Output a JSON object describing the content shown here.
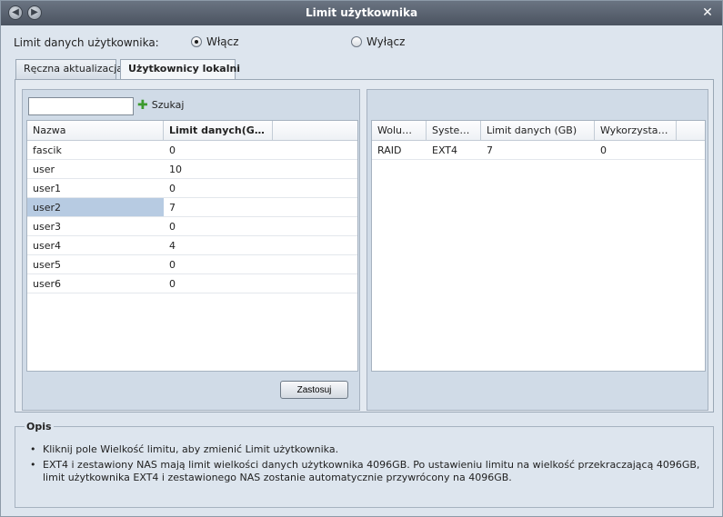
{
  "window": {
    "title": "Limit użytkownika"
  },
  "limit": {
    "label": "Limit danych użytkownika:",
    "on": "Włącz",
    "off": "Wyłącz",
    "selected": "on"
  },
  "tabs": [
    {
      "label": "Ręczna aktualizacja"
    },
    {
      "label": "Użytkownicy lokalni"
    }
  ],
  "search": {
    "value": "",
    "button": "Szukaj"
  },
  "users": {
    "columns": [
      "Nazwa",
      "Limit danych(GB)"
    ],
    "rows": [
      [
        "fascik",
        "0"
      ],
      [
        "user",
        "10"
      ],
      [
        "user1",
        "0"
      ],
      [
        "user2",
        "7"
      ],
      [
        "user3",
        "0"
      ],
      [
        "user4",
        "4"
      ],
      [
        "user5",
        "0"
      ],
      [
        "user6",
        "0"
      ]
    ],
    "selected_row": 3
  },
  "volumes": {
    "columns": [
      "Wolumen",
      "System...",
      "Limit danych (GB)",
      "Wykorzystan..."
    ],
    "rows": [
      [
        "RAID",
        "EXT4",
        "7",
        "0"
      ]
    ]
  },
  "apply_label": "Zastosuj",
  "opis": {
    "title": "Opis",
    "items": [
      "Kliknij pole Wielkość limitu, aby zmienić Limit użytkownika.",
      "EXT4 i zestawiony NAS mają limit wielkości danych użytkownika 4096GB. Po ustawieniu limitu na wielkość przekraczającą 4096GB, limit użytkownika EXT4 i zestawionego NAS zostanie automatycznie przywrócony na 4096GB."
    ]
  }
}
